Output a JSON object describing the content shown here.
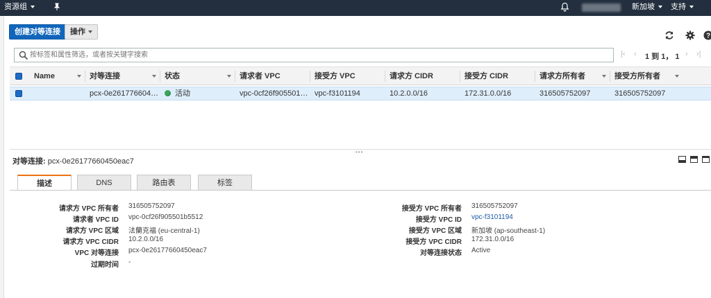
{
  "topnav": {
    "resource_groups": "资源组",
    "region": "新加坡",
    "support": "支持"
  },
  "toolbar": {
    "create_button": "创建对等连接",
    "actions_button": "操作"
  },
  "icons": {
    "search": "search-icon",
    "refresh": "refresh-icon",
    "settings": "gear-icon",
    "help": "help-icon",
    "pin": "pin-icon",
    "bell": "bell-icon"
  },
  "search": {
    "placeholder": "按标签和属性筛选，或者按关键字搜索"
  },
  "pagination": {
    "text": "1 到 1， 1"
  },
  "table": {
    "headers": [
      "Name",
      "对等连接",
      "状态",
      "请求者 VPC",
      "接受方 VPC",
      "请求方 CIDR",
      "接受方 CIDR",
      "请求方所有者",
      "接受方所有者"
    ],
    "rows": [
      {
        "name": "",
        "peering_connection": "pcx-0e261776604…",
        "status": "活动",
        "requester_vpc": "vpc-0cf26f905501…",
        "accepter_vpc": "vpc-f3101194",
        "requester_cidr": "10.2.0.0/16",
        "accepter_cidr": "172.31.0.0/16",
        "requester_owner": "316505752097",
        "accepter_owner": "316505752097"
      }
    ]
  },
  "detail": {
    "title_label": "对等连接:",
    "title_value": "pcx-0e26177660450eac7",
    "tabs": [
      "描述",
      "DNS",
      "路由表",
      "标签"
    ],
    "left": [
      {
        "label": "请求方 VPC 所有者",
        "value": "316505752097"
      },
      {
        "label": "请求者 VPC ID",
        "value": "vpc-0cf26f905501b5512"
      },
      {
        "label": "请求方 VPC 区域",
        "value": "法蘭克福 (eu-central-1)"
      },
      {
        "label": "请求方 VPC CIDR",
        "value": "10.2.0.0/16"
      },
      {
        "label": "VPC 对等连接",
        "value": "pcx-0e26177660450eac7"
      },
      {
        "label": "过期时间",
        "value": "-"
      }
    ],
    "right": [
      {
        "label": "接受方 VPC 所有者",
        "value": "316505752097"
      },
      {
        "label": "接受方 VPC ID",
        "value": "vpc-f3101194"
      },
      {
        "label": "接受方 VPC 区域",
        "value": "新加坡 (ap-southeast-1)"
      },
      {
        "label": "接受方 VPC CIDR",
        "value": "172.31.0.0/16"
      },
      {
        "label": "对等连接状态",
        "value": "Active"
      }
    ]
  },
  "colors": {
    "nav_bg": "#232f3e",
    "primary": "#1166bb",
    "selected_row": "#dfeefb",
    "status_active": "#3ba55c",
    "tab_accent": "#ec7211",
    "link": "#1f5aa6"
  }
}
